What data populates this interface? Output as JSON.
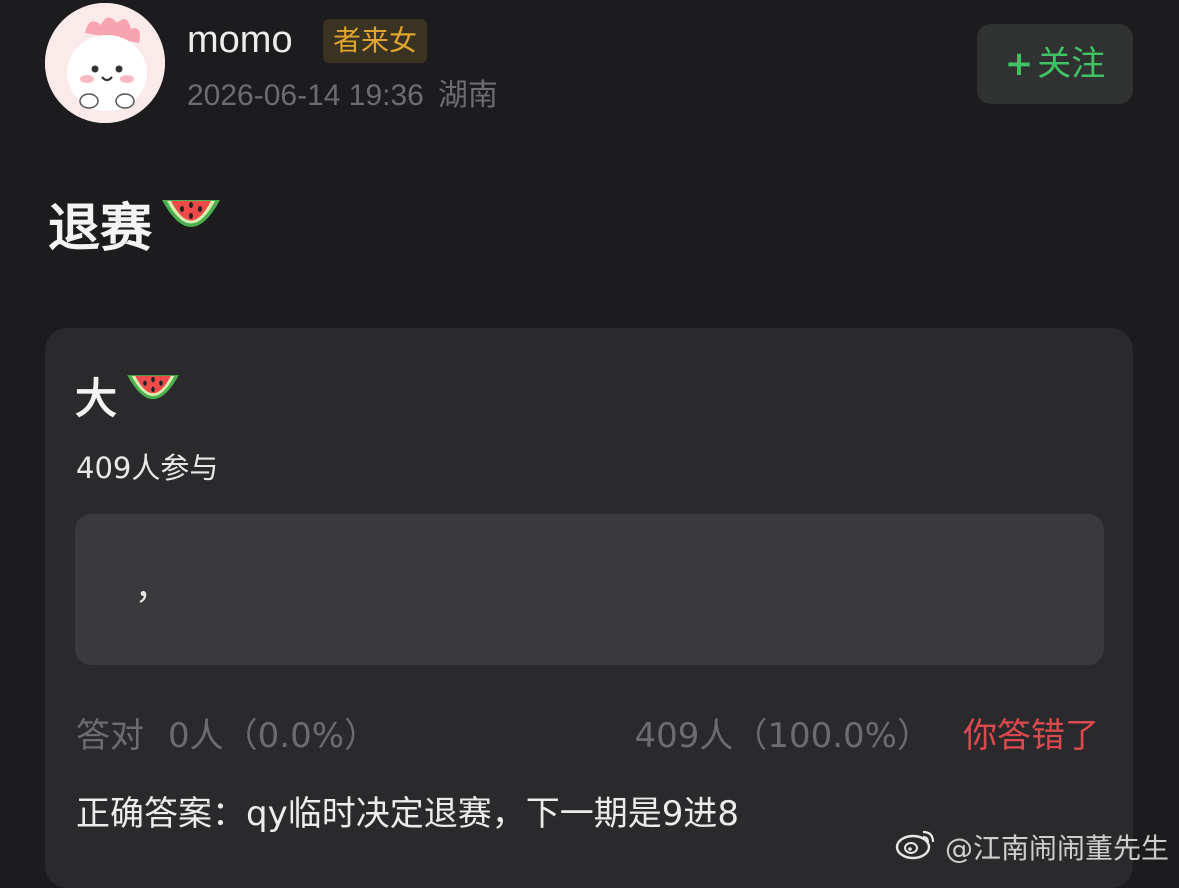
{
  "header": {
    "username": "momo",
    "user_tag": "者来女",
    "timestamp": "2026-06-14 19:36",
    "location": "湖南",
    "follow_plus": "+",
    "follow_label": "关注"
  },
  "post": {
    "title": "退赛"
  },
  "quiz": {
    "question": "大",
    "participants": "409人参与",
    "option_text": "，",
    "correct_label": "答对",
    "correct_stat": "0人（0.0%）",
    "wrong_stat": "409人（100.0%）",
    "verdict": "你答错了",
    "answer": "正确答案：qy临时决定退赛，下一期是9进8"
  },
  "watermark": {
    "text": "@江南闹闹董先生"
  },
  "colors": {
    "background": "#1c1c1e",
    "card": "#2a2a2c",
    "option": "#3a3a3c",
    "follow_text": "#40c365",
    "tag_text": "#e0a52e",
    "wrong_text": "#dc4a4f"
  },
  "icons": {
    "title_emoji": "watermelon-icon",
    "question_emoji": "watermelon-icon",
    "watermark_logo": "weibo-logo-icon"
  }
}
